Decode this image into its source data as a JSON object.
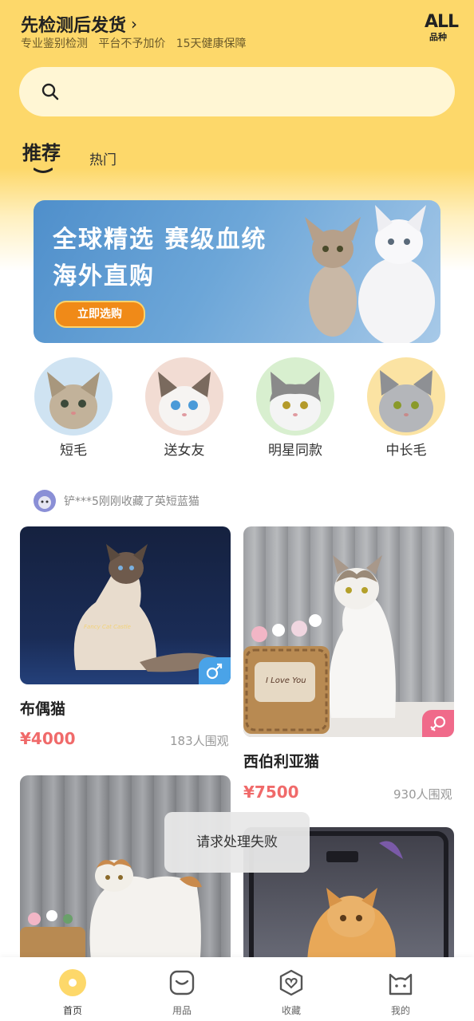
{
  "header": {
    "title": "先检测后发货",
    "subtitle": "专业鉴别检测   平台不予加价   15天健康保障",
    "all_badge_top": "ALL",
    "all_badge_bottom": "品种"
  },
  "search": {
    "placeholder": ""
  },
  "tabs": [
    {
      "label": "推荐",
      "active": true
    },
    {
      "label": "热门",
      "active": false
    }
  ],
  "banner": {
    "line1": "全球精选 赛级血统",
    "line2": "海外直购",
    "button": "立即选购"
  },
  "categories": [
    {
      "label": "短毛",
      "bg": "#cfe3f2"
    },
    {
      "label": "送女友",
      "bg": "#f2dcd3"
    },
    {
      "label": "明星同款",
      "bg": "#d8efcf"
    },
    {
      "label": "中长毛",
      "bg": "#fbe3a3"
    }
  ],
  "notice": {
    "text": "铲***5刚刚收藏了英短蓝猫"
  },
  "products": [
    {
      "name": "布偶猫",
      "price": "¥4000",
      "viewers": "183人围观",
      "gender": "male",
      "watermark": "Fancy Cat Castle"
    },
    {
      "name": "西伯利亚猫",
      "price": "¥7500",
      "viewers": "930人围观",
      "gender": "female",
      "basket": "I Love You"
    },
    {
      "name": "",
      "price": "",
      "viewers": ""
    },
    {
      "name": "",
      "price": "",
      "viewers": ""
    }
  ],
  "toast": "请求处理失败",
  "bottom_nav": [
    {
      "label": "首页",
      "icon": "home-icon",
      "active": true
    },
    {
      "label": "用品",
      "icon": "bag-icon",
      "active": false
    },
    {
      "label": "收藏",
      "icon": "heart-icon",
      "active": false
    },
    {
      "label": "我的",
      "icon": "cat-face-icon",
      "active": false
    }
  ],
  "colors": {
    "accent": "#fdd86a",
    "price": "#f06a6a",
    "male": "#4aa3e8",
    "female": "#f06a8a"
  }
}
